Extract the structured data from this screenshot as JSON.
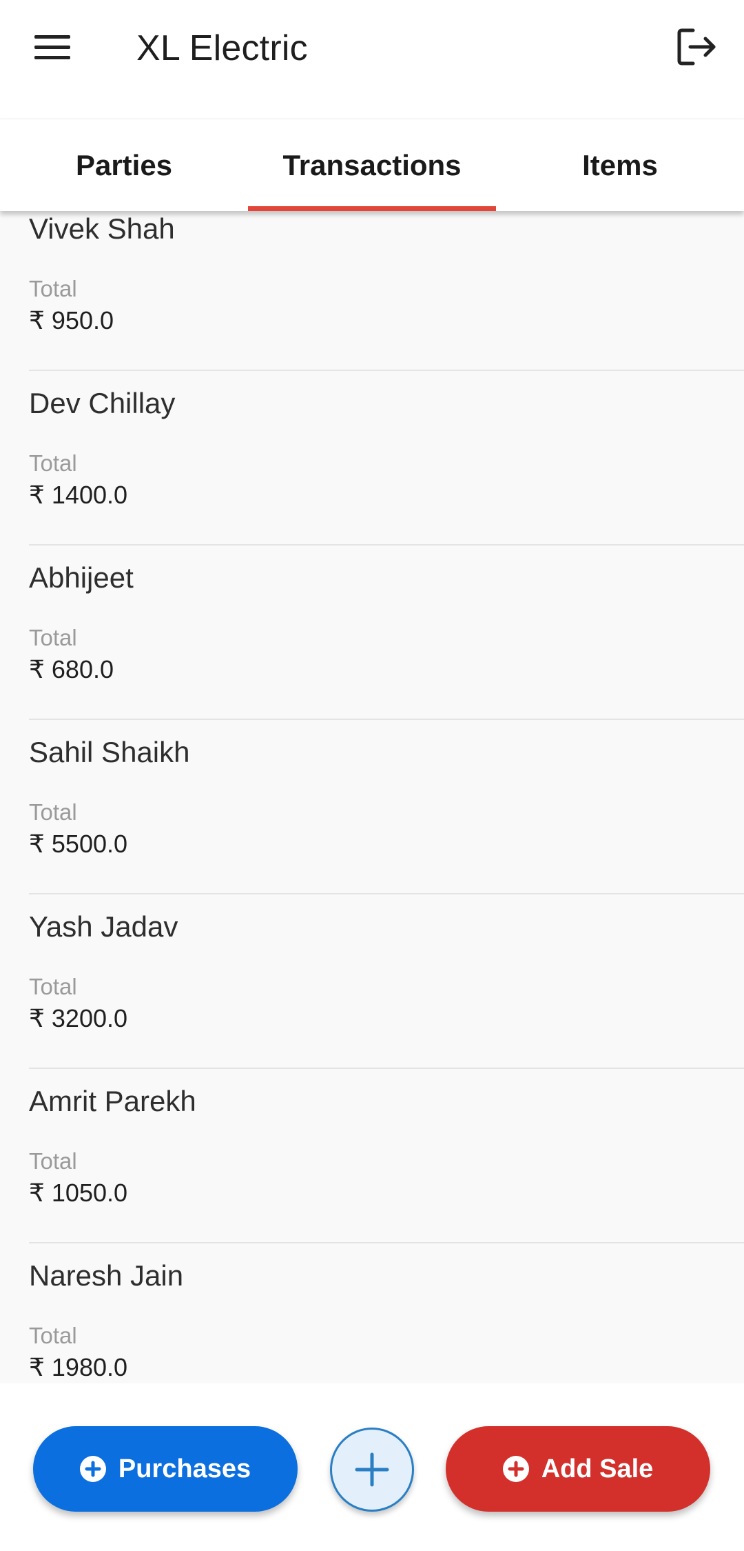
{
  "app": {
    "title": "XL Electric"
  },
  "tabs": [
    {
      "label": "Parties",
      "active": false
    },
    {
      "label": "Transactions",
      "active": true
    },
    {
      "label": "Items",
      "active": false
    }
  ],
  "colors": {
    "tab_indicator": "#e2453a",
    "purchases": "#0b6fe0",
    "add_sale": "#d3302c",
    "fab": "#2a7fc4"
  },
  "icons": {
    "menu": "menu-icon",
    "logout": "logout-icon",
    "add": "plus-icon"
  },
  "transactions": [
    {
      "name": "Vivek Shah",
      "total_label": "Total",
      "amount": "₹ 950.0"
    },
    {
      "name": "Dev Chillay",
      "total_label": "Total",
      "amount": "₹ 1400.0"
    },
    {
      "name": "Abhijeet",
      "total_label": "Total",
      "amount": "₹ 680.0"
    },
    {
      "name": "Sahil Shaikh",
      "total_label": "Total",
      "amount": "₹ 5500.0"
    },
    {
      "name": "Yash Jadav",
      "total_label": "Total",
      "amount": "₹ 3200.0"
    },
    {
      "name": "Amrit Parekh",
      "total_label": "Total",
      "amount": "₹ 1050.0"
    },
    {
      "name": "Naresh Jain",
      "total_label": "Total",
      "amount": "₹ 1980.0"
    }
  ],
  "bottom": {
    "purchases_label": "Purchases",
    "add_sale_label": "Add Sale"
  }
}
